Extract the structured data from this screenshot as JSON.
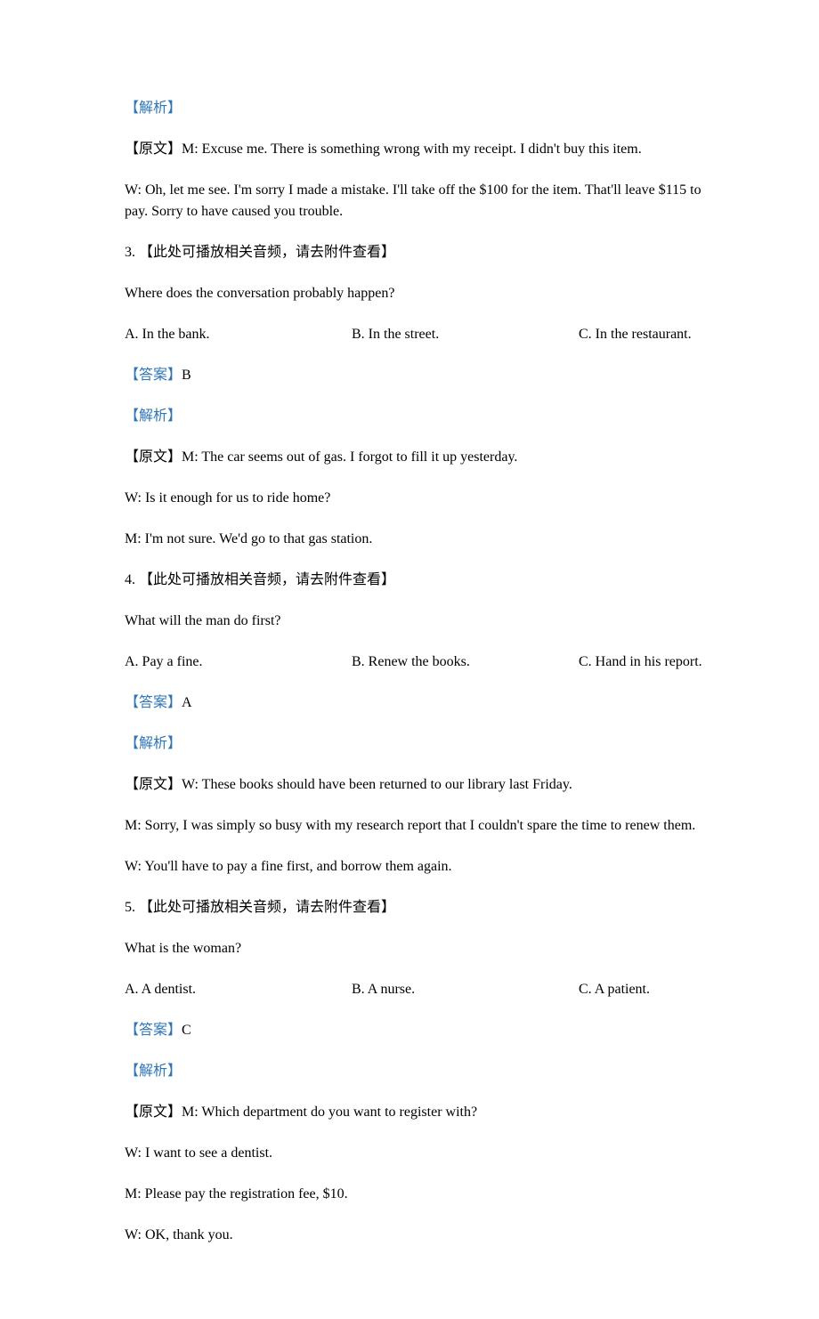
{
  "labels": {
    "analysis": "【解析】",
    "original_prefix": "【原文】",
    "answer_prefix": "【答案】",
    "audio_note_prefix": "【此处可播放相关音频，请去附件查看】"
  },
  "q2": {
    "analysis": "【解析】",
    "original1": "【原文】M: Excuse me. There is something wrong with my receipt. I didn't buy this item.",
    "original2": "W: Oh, let me see. I'm sorry I made a mistake. I'll take off the $100 for the item. That'll leave $115 to pay. Sorry to have caused you trouble."
  },
  "q3": {
    "header": "3. 【此处可播放相关音频，请去附件查看】",
    "question": "Where does the conversation probably happen?",
    "optA": "A. In the bank.",
    "optB": "B. In the street.",
    "optC": "C. In the restaurant.",
    "answer_label": "【答案】",
    "answer_value": "B",
    "analysis": "【解析】",
    "original1": "【原文】M: The car seems out of gas. I forgot to fill it up yesterday.",
    "original2": "W: Is it enough for us to ride home?",
    "original3": "M: I'm not sure. We'd go to that gas station."
  },
  "q4": {
    "header": "4. 【此处可播放相关音频，请去附件查看】",
    "question": "What will the man do first?",
    "optA": "A. Pay a fine.",
    "optB": "B. Renew the books.",
    "optC": "C. Hand in his report.",
    "answer_label": "【答案】",
    "answer_value": "A",
    "analysis": "【解析】",
    "original1": "【原文】W: These books should have been returned to our library last Friday.",
    "original2": "M: Sorry, I was simply so busy with my research report that I couldn't spare the time to renew them.",
    "original3": "W: You'll have to pay a fine first, and borrow them again."
  },
  "q5": {
    "header": "5. 【此处可播放相关音频，请去附件查看】",
    "question": "What is the woman?",
    "optA": "A. A dentist.",
    "optB": "B. A nurse.",
    "optC": "C. A patient.",
    "answer_label": "【答案】",
    "answer_value": "C",
    "analysis": "【解析】",
    "original1": "【原文】M: Which department do you want to register with?",
    "original2": "W: I want to see a dentist.",
    "original3": "M: Please pay the registration fee, $10.",
    "original4": "W: OK, thank you."
  }
}
